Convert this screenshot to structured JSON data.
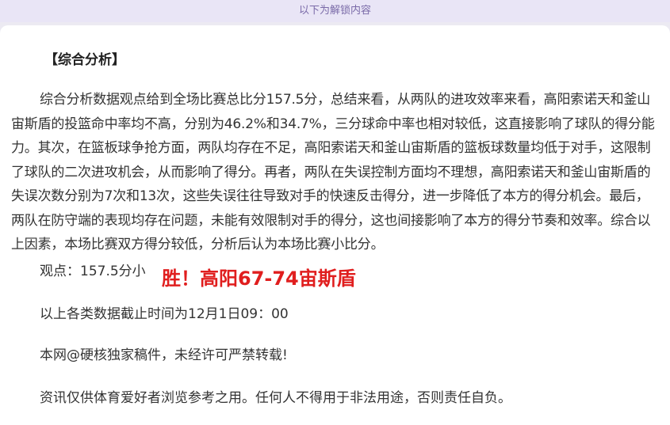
{
  "banner": {
    "text": "以下为解锁内容"
  },
  "section": {
    "heading": "【综合分析】",
    "body": "综合分析数据观点给到全场比赛总比分157.5分，总结来看，从两队的进攻效率来看，高阳索诺天和釜山宙斯盾的投篮命中率均不高，分别为46.2%和34.7%，三分球命中率也相对较低，这直接影响了球队的得分能力。其次，在篮板球争抢方面，两队均存在不足，高阳索诺天和釜山宙斯盾的篮板球数量均低于对手，这限制了球队的二次进攻机会，从而影响了得分。再者，两队在失误控制方面均不理想，高阳索诺天和釜山宙斯盾的失误次数分别为7次和13次，这些失误往往导致对手的快速反击得分，进一步降低了本方的得分机会。最后，两队在防守端的表现均存在问题，未能有效限制对手的得分，这也间接影响了本方的得分节奏和效率。综合以上因素，本场比赛双方得分较低，分析后认为本场比赛小比分。",
    "opinion": "观点：157.5分小",
    "result": "胜！高阳67-74宙斯盾",
    "cutoff": "以上各类数据截止时间为12月1日09：00",
    "copyright": "本网@硬核独家稿件，未经许可严禁转载!",
    "disclaimer": "资讯仅供体育爱好者浏览参考之用。任何人不得用于非法用途，否则责任自负。"
  },
  "colors": {
    "result": "#e01e1e",
    "banner_bg": "#e9e5f6",
    "banner_text": "#7a6aa8"
  }
}
